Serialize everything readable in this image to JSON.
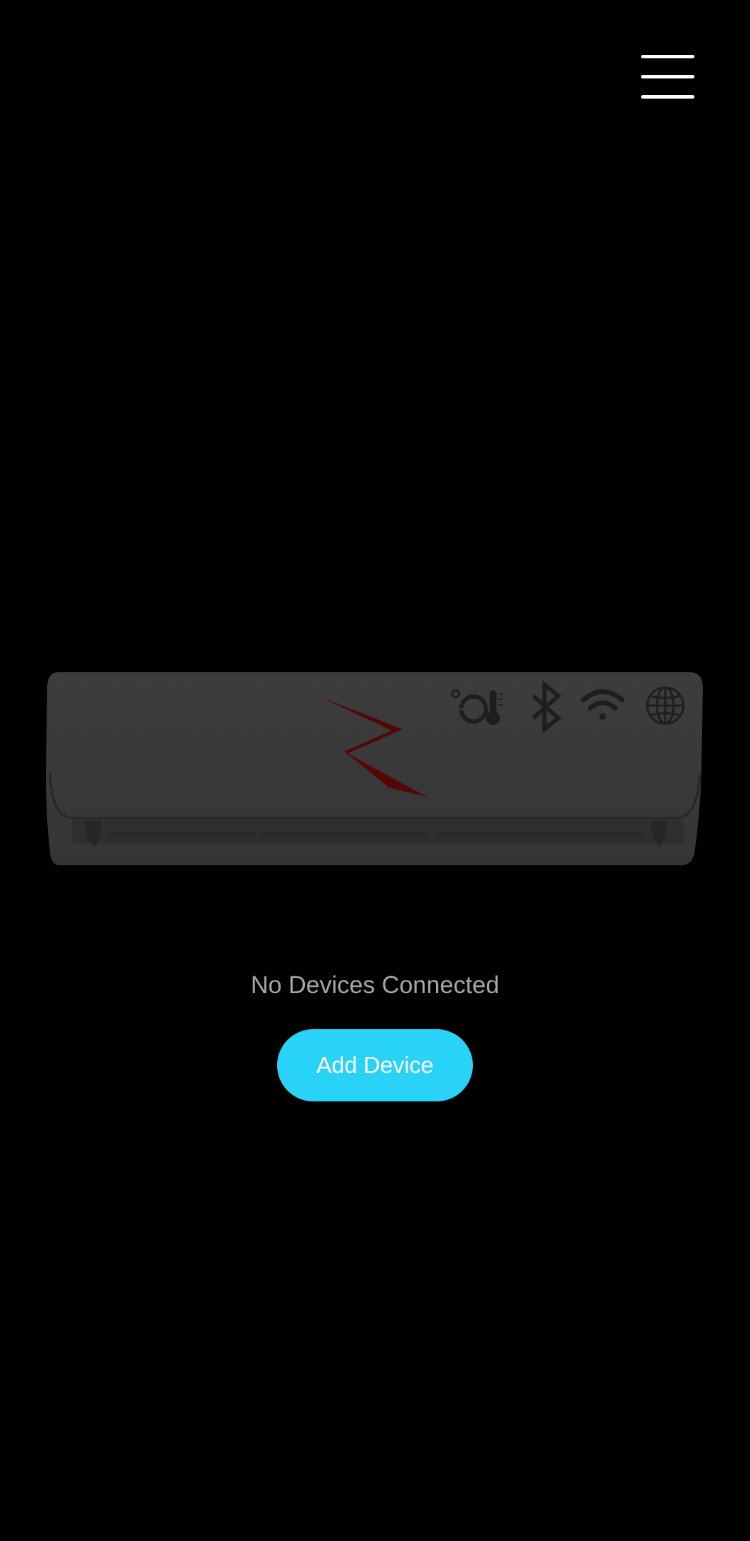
{
  "header": {
    "menu_icon": "hamburger-menu-icon"
  },
  "device_illustration": {
    "icons": [
      "celsius-thermometer-icon",
      "bluetooth-icon",
      "wifi-icon",
      "globe-icon",
      "lightning-logo-icon"
    ],
    "celsius_label": "°C",
    "colors": {
      "body": "#3a3a3a",
      "logo": "#5a0a0a",
      "icons": "#1e1e1e"
    }
  },
  "status": {
    "message": "No Devices Connected"
  },
  "actions": {
    "add_device_label": "Add Device",
    "accent_color": "#29d3f7"
  }
}
